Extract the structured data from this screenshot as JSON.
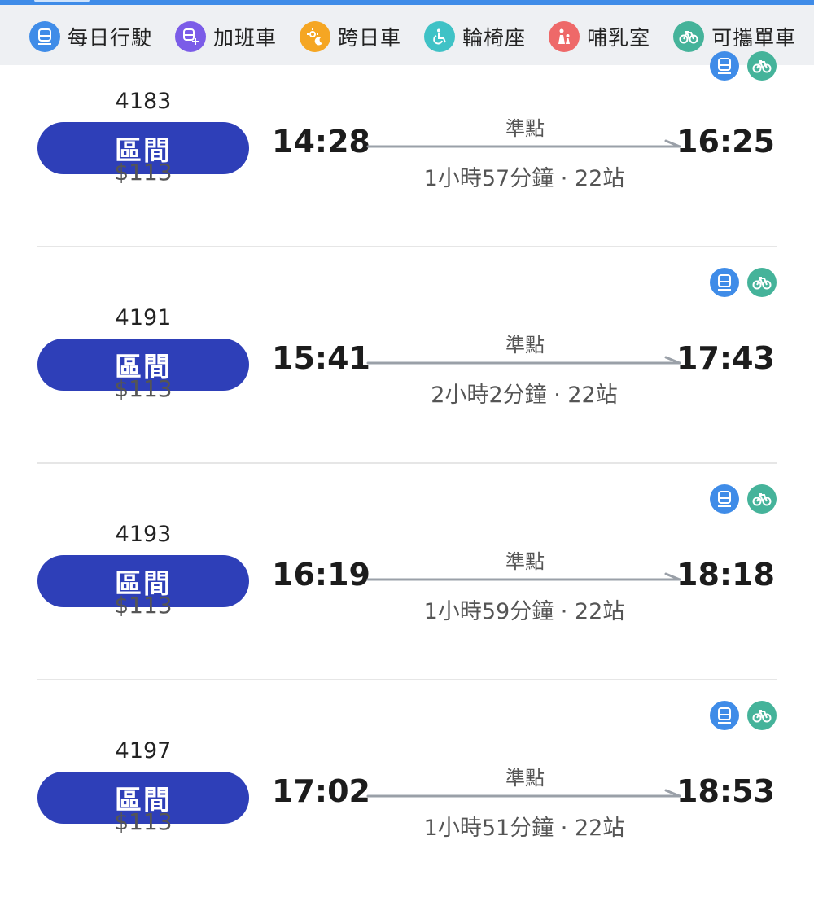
{
  "legend": [
    {
      "label": "每日行駛",
      "icon": "train-icon",
      "color": "#3f8ce8"
    },
    {
      "label": "加班車",
      "icon": "train-plus-icon",
      "color": "#7b5ce8"
    },
    {
      "label": "跨日車",
      "icon": "sun-moon-icon",
      "color": "#f5a623"
    },
    {
      "label": "輪椅座",
      "icon": "wheelchair-icon",
      "color": "#3fc2c6"
    },
    {
      "label": "哺乳室",
      "icon": "nursing-room-icon",
      "color": "#ee6969"
    },
    {
      "label": "可攜單車",
      "icon": "bicycle-icon",
      "color": "#45b39a"
    }
  ],
  "colors": {
    "pill": "#2e3fb8",
    "accent": "#3f8ce8"
  },
  "trains": [
    {
      "number": "4183",
      "type": "區間",
      "price": "$113",
      "depart": "14:28",
      "arrive": "16:25",
      "status": "準點",
      "duration": "1小時57分鐘",
      "stops": "22站",
      "features": [
        "train-icon",
        "bicycle-icon"
      ]
    },
    {
      "number": "4191",
      "type": "區間",
      "price": "$113",
      "depart": "15:41",
      "arrive": "17:43",
      "status": "準點",
      "duration": "2小時2分鐘",
      "stops": "22站",
      "features": [
        "train-icon",
        "bicycle-icon"
      ]
    },
    {
      "number": "4193",
      "type": "區間",
      "price": "$113",
      "depart": "16:19",
      "arrive": "18:18",
      "status": "準點",
      "duration": "1小時59分鐘",
      "stops": "22站",
      "features": [
        "train-icon",
        "bicycle-icon"
      ]
    },
    {
      "number": "4197",
      "type": "區間",
      "price": "$113",
      "depart": "17:02",
      "arrive": "18:53",
      "status": "準點",
      "duration": "1小時51分鐘",
      "stops": "22站",
      "features": [
        "train-icon",
        "bicycle-icon"
      ]
    }
  ],
  "separator": " · "
}
